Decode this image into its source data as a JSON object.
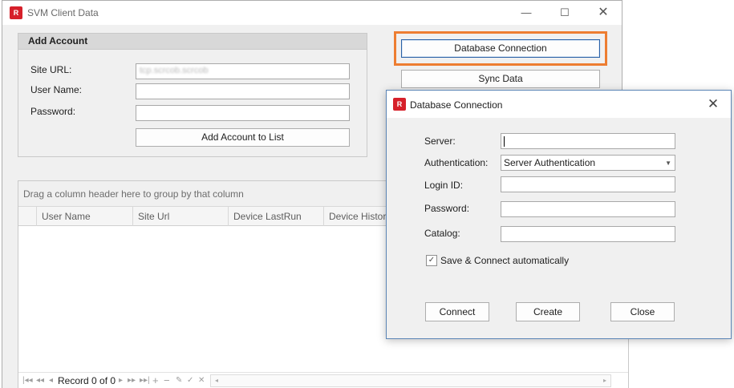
{
  "window": {
    "title": "SVM Client Data",
    "icon": "app-logo-icon",
    "controls": {
      "minimize": "—",
      "maximize": "☐",
      "close": "✕"
    }
  },
  "add_account": {
    "heading": "Add Account",
    "site_url_label": "Site URL:",
    "site_url_value": "tcp.scrcob.scrcob",
    "user_name_label": "User Name:",
    "user_name_value": "",
    "password_label": "Password:",
    "password_value": "",
    "add_button": "Add Account to List"
  },
  "actions": {
    "database_connection": "Database Connection",
    "sync_data": "Sync Data",
    "highlight_color": "#ed7d31"
  },
  "grid": {
    "group_hint": "Drag a column header here to group by that column",
    "columns": [
      "User Name",
      "Site Url",
      "Device LastRun",
      "Device History L"
    ],
    "rows": [],
    "record_text": "Record 0 of 0"
  },
  "dialog": {
    "title": "Database Connection",
    "server_label": "Server:",
    "server_value": "",
    "authentication_label": "Authentication:",
    "authentication_value": "Server Authentication",
    "login_label": "Login ID:",
    "login_value": "",
    "password_label": "Password:",
    "password_value": "",
    "catalog_label": "Catalog:",
    "catalog_value": "",
    "save_connect_label": "Save & Connect automatically",
    "save_connect_checked": true,
    "connect_button": "Connect",
    "create_button": "Create",
    "close_button": "Close"
  },
  "colors": {
    "brand_red": "#d6202a",
    "dialog_border": "#5b85b6",
    "primary_button_border": "#2a61a6"
  }
}
